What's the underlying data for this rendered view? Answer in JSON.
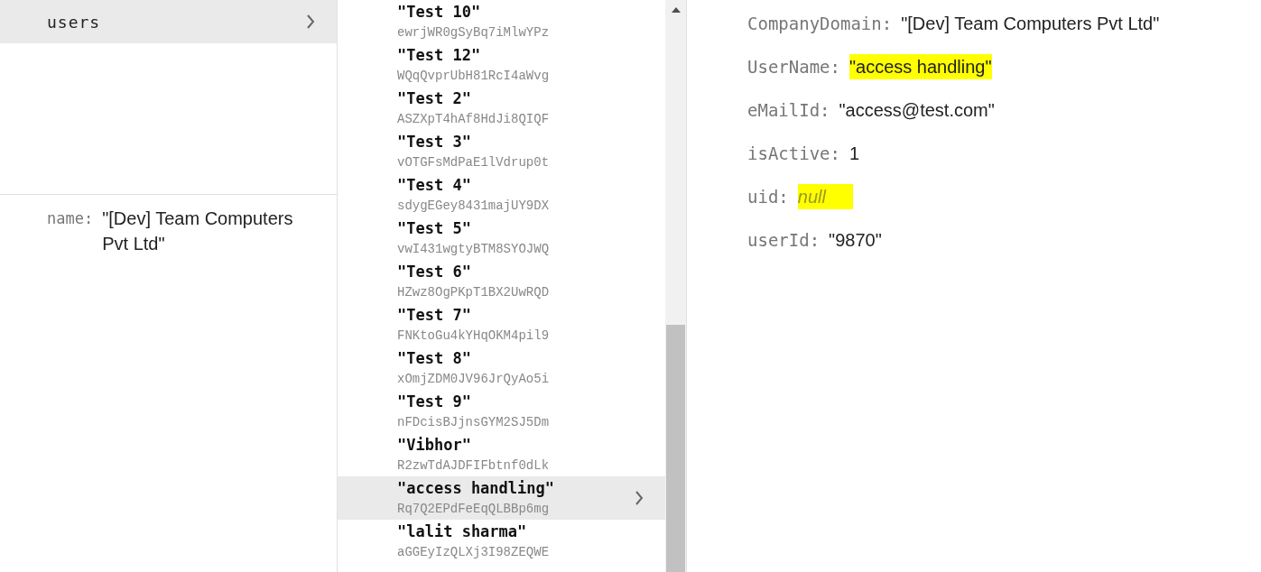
{
  "collections": [
    {
      "label": "users",
      "selected": true
    }
  ],
  "collection_fields": [
    {
      "key": "name:",
      "value": "\"[Dev] Team Computers Pvt Ltd\""
    }
  ],
  "documents": [
    {
      "title": "\"Test 10\"",
      "id": "ewrjWR0gSyBq7iMlwYPz",
      "selected": false
    },
    {
      "title": "\"Test 12\"",
      "id": "WQqQvprUbH81RcI4aWvg",
      "selected": false
    },
    {
      "title": "\"Test 2\"",
      "id": "ASZXpT4hAf8HdJi8QIQF",
      "selected": false
    },
    {
      "title": "\"Test 3\"",
      "id": "vOTGFsMdPaE1lVdrup0t",
      "selected": false
    },
    {
      "title": "\"Test 4\"",
      "id": "sdygEGey8431majUY9DX",
      "selected": false
    },
    {
      "title": "\"Test 5\"",
      "id": "vwI431wgtyBTM8SYOJWQ",
      "selected": false
    },
    {
      "title": "\"Test 6\"",
      "id": "HZwz8OgPKpT1BX2UwRQD",
      "selected": false
    },
    {
      "title": "\"Test 7\"",
      "id": "FNKtoGu4kYHqOKM4pil9",
      "selected": false
    },
    {
      "title": "\"Test 8\"",
      "id": "xOmjZDM0JV96JrQyAo5i",
      "selected": false
    },
    {
      "title": "\"Test 9\"",
      "id": "nFDcisBJjnsGYM2SJ5Dm",
      "selected": false
    },
    {
      "title": "\"Vibhor\"",
      "id": "R2zwTdAJDFIFbtnf0dLk",
      "selected": false
    },
    {
      "title": "\"access handling\"",
      "id": "Rq7Q2EPdFeEqQLBBp6mg",
      "selected": true
    },
    {
      "title": "\"lalit sharma\"",
      "id": "aGGEyIzQLXj3I98ZEQWE",
      "selected": false
    }
  ],
  "document_fields": [
    {
      "key": "CompanyDomain:",
      "value": "\"[Dev] Team Computers Pvt Ltd\"",
      "kind": "string",
      "highlighted": false
    },
    {
      "key": "UserName:",
      "value": "\"access handling\"",
      "kind": "string",
      "highlighted": true
    },
    {
      "key": "eMailId:",
      "value": "\"access@test.com\"",
      "kind": "string",
      "highlighted": false
    },
    {
      "key": "isActive:",
      "value": "1",
      "kind": "number",
      "highlighted": false
    },
    {
      "key": "uid:",
      "value": "null",
      "kind": "null",
      "highlighted": true
    },
    {
      "key": "userId:",
      "value": "\"9870\"",
      "kind": "string",
      "highlighted": false
    }
  ]
}
